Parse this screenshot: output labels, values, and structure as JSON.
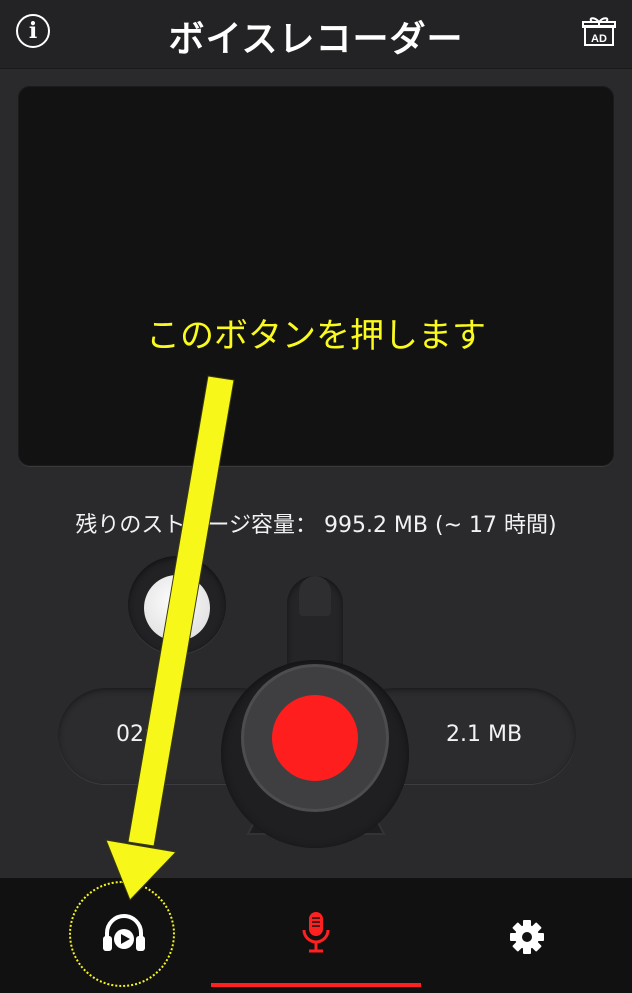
{
  "header": {
    "title": "ボイスレコーダー",
    "info_glyph": "i",
    "ad_label": "AD"
  },
  "display": {},
  "storage_text": "残りのストレージ容量： 995.2 MB (~ 17 時間)",
  "recorder": {
    "time": "02:",
    "size": "2.1 MB"
  },
  "annotation": {
    "text": "このボタンを押します"
  },
  "nav": {
    "items": [
      {
        "id": "playback",
        "icon": "headphones-play-icon"
      },
      {
        "id": "record",
        "icon": "microphone-icon",
        "active": true
      },
      {
        "id": "settings",
        "icon": "gear-icon"
      }
    ]
  },
  "colors": {
    "accent": "#ff1e1e",
    "annotation": "#fafa1e",
    "background": "#2a2a2d"
  }
}
